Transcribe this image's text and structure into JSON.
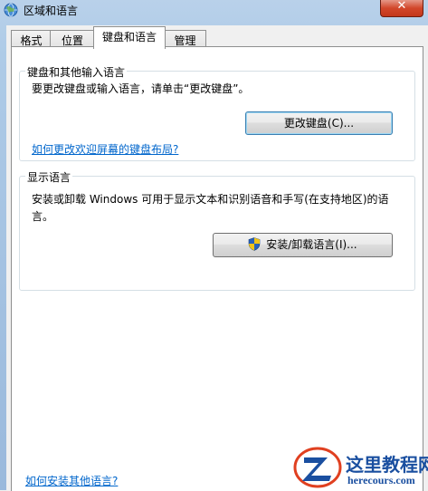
{
  "window": {
    "title": "区域和语言",
    "close_glyph": "✕"
  },
  "tabs": [
    {
      "label": "格式"
    },
    {
      "label": "位置"
    },
    {
      "label": "键盘和语言",
      "active": true
    },
    {
      "label": "管理"
    }
  ],
  "keyboard_group": {
    "legend": "键盘和其他输入语言",
    "description": "要更改键盘或输入语言，请单击“更改键盘”。",
    "change_keyboard_button": "更改键盘(C)...",
    "welcome_screen_link": "如何更改欢迎屏幕的键盘布局?"
  },
  "display_group": {
    "legend": "显示语言",
    "description": "安装或卸载 Windows 可用于显示文本和识别语音和手写(在支持地区)的语言。",
    "install_button": "安装/卸载语言(I)..."
  },
  "footer_link": "如何安装其他语言?",
  "watermark": {
    "title": "这里教程网",
    "url": "herecours.com"
  },
  "colors": {
    "link": "#0066cc",
    "close": "#c3371b",
    "shield_blue": "#2a62b8",
    "shield_yellow": "#f0c419"
  },
  "icons": {
    "window": "globe-icon",
    "uac": "uac-shield-icon"
  }
}
